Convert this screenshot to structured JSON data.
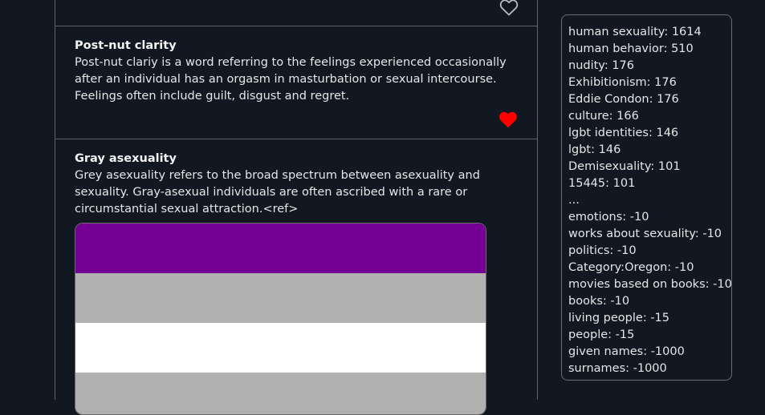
{
  "posts": {
    "top": {
      "liked": false
    },
    "clarity": {
      "title": "Post-nut clarity",
      "body": "Post-nut clariy is a word referring to the feelings experienced occasionally after an individual has an orgasm in masturbation or sexual intercourse. Feelings often include guilt, disgust and regret.",
      "liked": true
    },
    "gray": {
      "title": "Gray asexuality",
      "body": "Grey asexuality refers to the broad spectrum between asexuality and sexuality. Gray-asexual individuals are often ascribed with a rare or circumstantial sexual attraction.<ref>",
      "flag_colors": [
        "#740094",
        "#b0b0b0",
        "#ffffff",
        "#b0b0b0"
      ]
    }
  },
  "colors": {
    "heart_liked": "#ff0000",
    "heart_outline": "#b5bcc4",
    "background": "#111821"
  },
  "icons": {
    "like": "heart-icon"
  },
  "tags": [
    "human sexuality: 1614",
    "human behavior: 510",
    "nudity: 176",
    "Exhibitionism: 176",
    "Eddie Condon: 176",
    "culture: 166",
    "lgbt identities: 146",
    "lgbt: 146",
    "Demisexuality: 101",
    "15445: 101",
    "...",
    "emotions: -10",
    "works about sexuality: -10",
    "politics: -10",
    "Category:Oregon: -10",
    "movies based on books: -10",
    "books: -10",
    "living people: -15",
    "people: -15",
    "given names: -1000",
    "surnames: -1000"
  ]
}
